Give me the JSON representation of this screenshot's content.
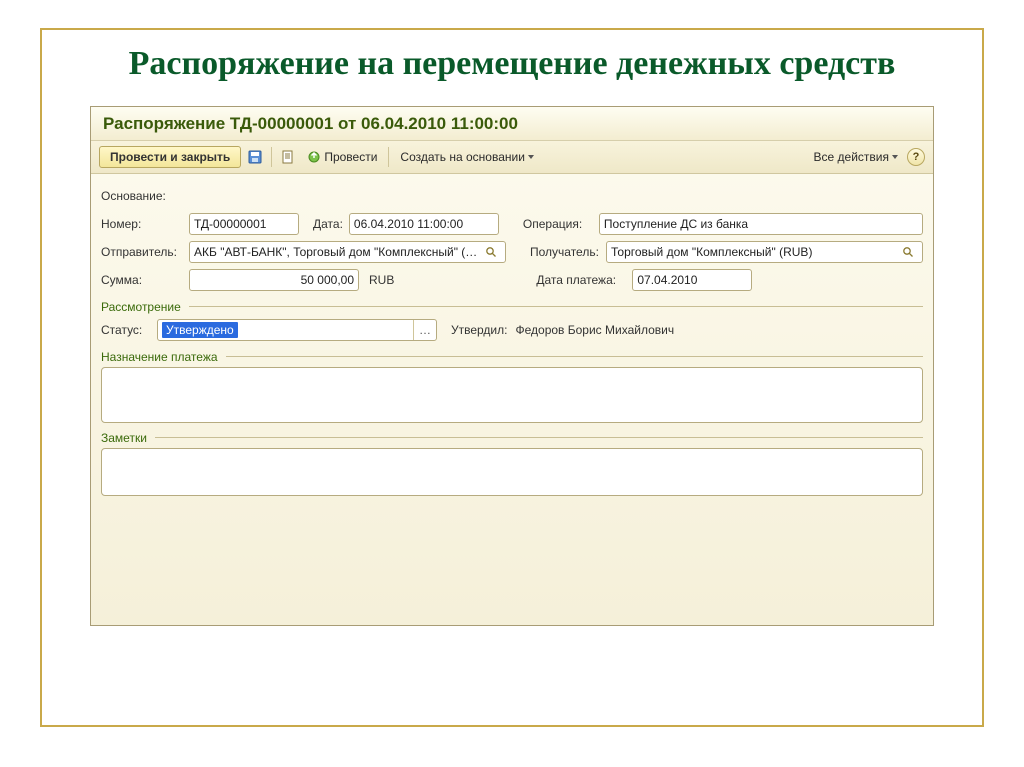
{
  "slide": {
    "title": "Распоряжение на перемещение денежных средств"
  },
  "window": {
    "doc_title": "Распоряжение ТД-00000001 от 06.04.2010 11:00:00",
    "toolbar": {
      "post_close": "Провести и закрыть",
      "post": "Провести",
      "create_based": "Создать на основании",
      "all_actions": "Все действия",
      "help": "?"
    },
    "form": {
      "basis_label": "Основание:",
      "number_label": "Номер:",
      "number_value": "ТД-00000001",
      "date_label": "Дата:",
      "date_value": "06.04.2010 11:00:00",
      "operation_label": "Операция:",
      "operation_value": "Поступление ДС из банка",
      "sender_label": "Отправитель:",
      "sender_value": "АКБ \"АВТ-БАНК\", Торговый дом \"Комплексный\" (RUB…",
      "receiver_label": "Получатель:",
      "receiver_value": "Торговый дом \"Комплексный\" (RUB)",
      "sum_label": "Сумма:",
      "sum_value": "50 000,00",
      "sum_currency": "RUB",
      "paydate_label": "Дата платежа:",
      "paydate_value": "07.04.2010"
    },
    "review": {
      "group": "Рассмотрение",
      "status_label": "Статус:",
      "status_value": "Утверждено",
      "approved_label": "Утвердил:",
      "approved_value": "Федоров Борис Михайлович"
    },
    "purpose": {
      "group": "Назначение платежа"
    },
    "notes": {
      "group": "Заметки"
    }
  }
}
